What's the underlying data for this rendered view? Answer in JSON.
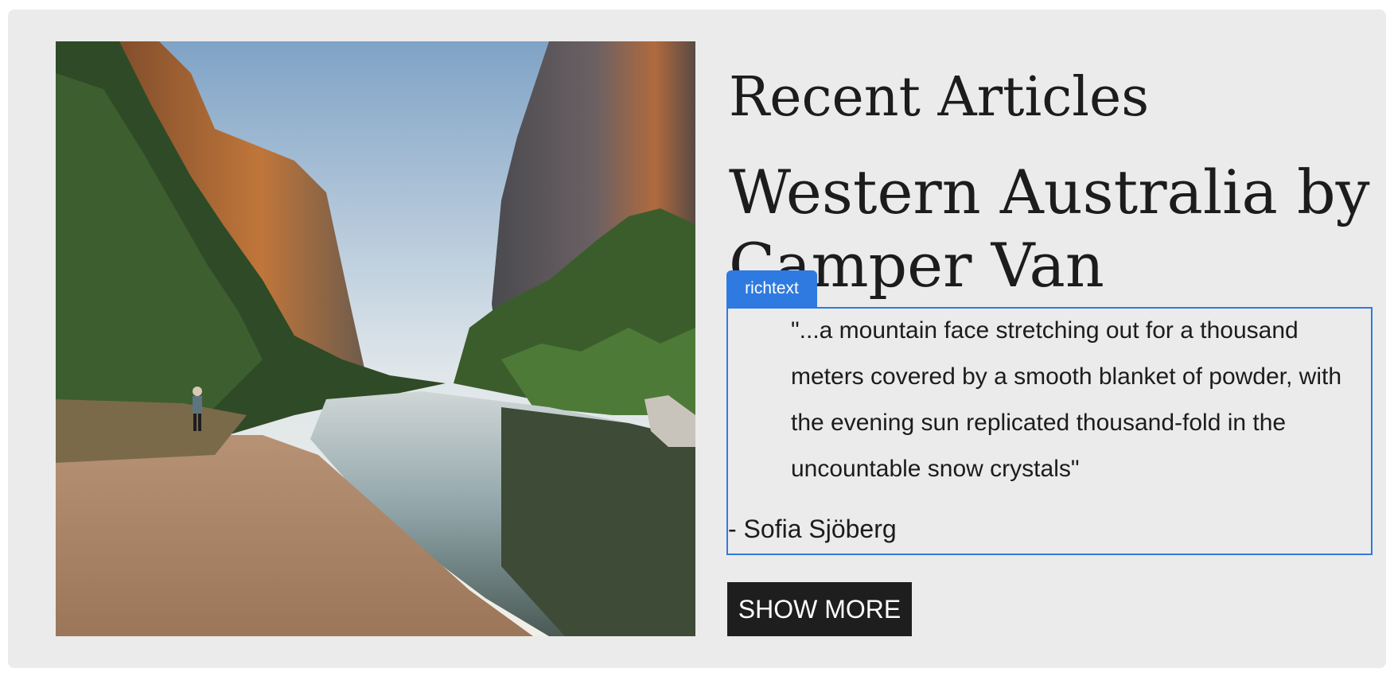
{
  "section": {
    "title": "Recent Articles"
  },
  "article": {
    "title": "Western Australia by Camper Van",
    "image_alt": "River winding through a rocky gorge with trees and a hiker on the bank",
    "quote": "\"...a mountain face stretching out for a thousand meters covered by a smooth blanket of powder, with the evening sun replicated thousand-fold in the uncountable snow crystals\"",
    "author": "- Sofia Sjöberg"
  },
  "editor": {
    "component_tag": "richtext",
    "accent_color": "#2f7ae0"
  },
  "actions": {
    "show_more_label": "SHOW MORE"
  }
}
